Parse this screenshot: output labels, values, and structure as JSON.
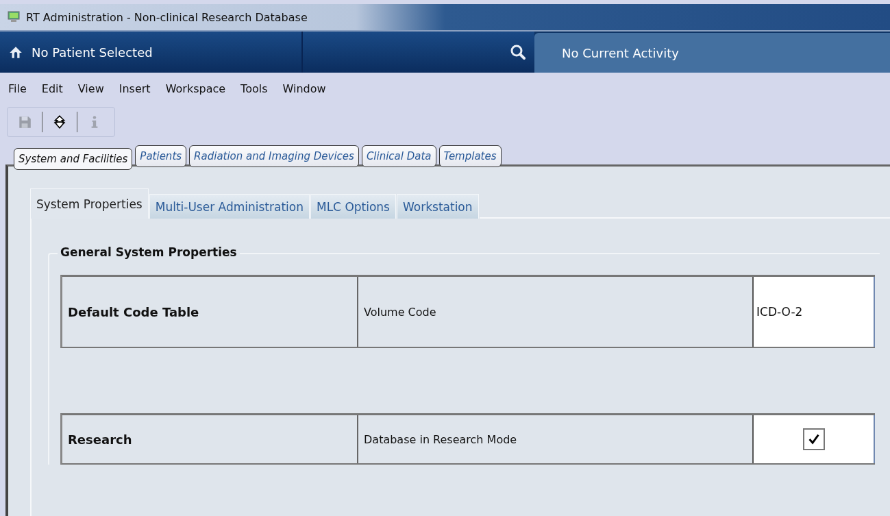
{
  "window": {
    "title": "RT Administration - Non-clinical Research Database"
  },
  "patient_bar": {
    "patient": "No Patient Selected",
    "activity": "No Current Activity"
  },
  "menu": [
    {
      "label": "File"
    },
    {
      "label": "Edit"
    },
    {
      "label": "View"
    },
    {
      "label": "Insert"
    },
    {
      "label": "Workspace"
    },
    {
      "label": "Tools"
    },
    {
      "label": "Window"
    }
  ],
  "toolbar": [
    {
      "kind": "save",
      "disabled": true
    },
    {
      "kind": "navigate",
      "disabled": false
    },
    {
      "kind": "info",
      "disabled": true
    }
  ],
  "nav_tabs": [
    {
      "label": "System and Facilities",
      "selected": true
    },
    {
      "label": "Patients",
      "selected": false
    },
    {
      "label": "Radiation and Imaging Devices",
      "selected": false
    },
    {
      "label": "Clinical Data",
      "selected": false
    },
    {
      "label": "Templates",
      "selected": false
    }
  ],
  "tabs": [
    {
      "label": "System Properties",
      "selected": true
    },
    {
      "label": "Multi-User Administration",
      "selected": false
    },
    {
      "label": "MLC Options",
      "selected": false
    },
    {
      "label": "Workstation",
      "selected": false
    }
  ],
  "group": {
    "title": "General System Properties",
    "rows": [
      {
        "name": "Default Code Table",
        "property": "Volume Code",
        "kind": "text",
        "value": "ICD-O-2"
      },
      {
        "name": "Research",
        "property": "Database in Research Mode",
        "kind": "checkbox",
        "checked": true
      }
    ]
  }
}
